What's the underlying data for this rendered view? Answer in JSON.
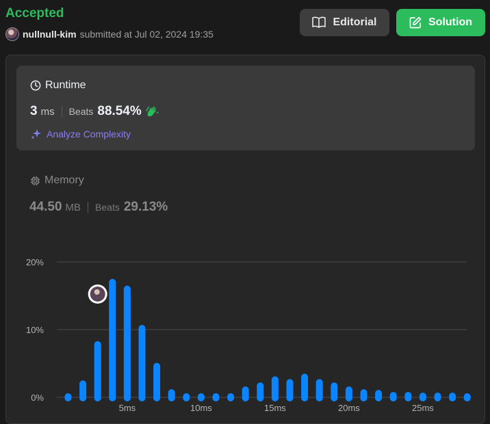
{
  "header": {
    "status": "Accepted",
    "username": "nullnull-kim",
    "submitted_text": "submitted at Jul 02, 2024 19:35",
    "editorial_label": "Editorial",
    "solution_label": "Solution"
  },
  "runtime": {
    "title": "Runtime",
    "value": "3",
    "unit": "ms",
    "beats_label": "Beats",
    "beats_pct": "88.54%",
    "analyze_label": "Analyze Complexity",
    "icon": "clock-icon"
  },
  "memory": {
    "title": "Memory",
    "value": "44.50",
    "unit": "MB",
    "beats_label": "Beats",
    "beats_pct": "29.13%",
    "icon": "chip-icon"
  },
  "colors": {
    "accent_green": "#2cbb5d",
    "bar_blue": "#0a84ff",
    "analyze_purple": "#8b7cf8"
  },
  "chart_data": {
    "type": "bar",
    "x": [
      1,
      2,
      3,
      4,
      5,
      6,
      7,
      8,
      9,
      10,
      11,
      12,
      13,
      14,
      15,
      16,
      17,
      18,
      19,
      20,
      21,
      22,
      23,
      24,
      25,
      26,
      27,
      28
    ],
    "values": [
      0.6,
      2.5,
      8.3,
      17.5,
      16.5,
      10.7,
      5.1,
      1.2,
      0.6,
      0.6,
      0.6,
      0.6,
      1.6,
      2.2,
      3.1,
      2.7,
      3.5,
      2.7,
      2.2,
      1.6,
      1.2,
      1.1,
      0.8,
      0.8,
      0.7,
      0.7,
      0.7,
      0.6
    ],
    "x_ticks": [
      {
        "x": 5,
        "label": "5ms"
      },
      {
        "x": 10,
        "label": "10ms"
      },
      {
        "x": 15,
        "label": "15ms"
      },
      {
        "x": 20,
        "label": "20ms"
      },
      {
        "x": 25,
        "label": "25ms"
      }
    ],
    "y_ticks": [
      {
        "y": 0,
        "label": "0%"
      },
      {
        "y": 10,
        "label": "10%"
      },
      {
        "y": 20,
        "label": "20%"
      }
    ],
    "ylim": [
      0,
      20
    ],
    "highlight_x": 3,
    "grid": true
  }
}
